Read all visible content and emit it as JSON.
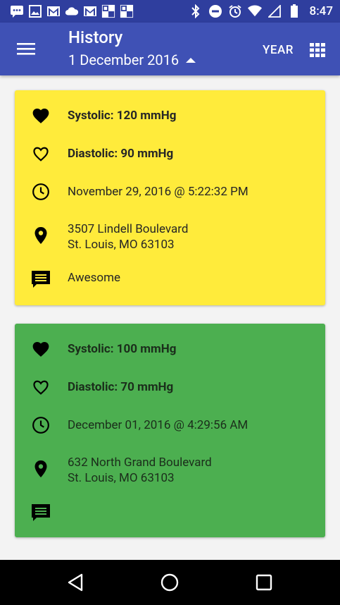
{
  "status_bar": {
    "time": "8:47"
  },
  "app_bar": {
    "title": "History",
    "date": "1 December 2016",
    "year_label": "YEAR"
  },
  "entries": [
    {
      "systolic": "Systolic: 120 mmHg",
      "diastolic": "Diastolic: 90 mmHg",
      "datetime": "November 29, 2016 @ 5:22:32 PM",
      "address_line1": "3507 Lindell Boulevard",
      "address_line2": "St. Louis, MO 63103",
      "comment": "Awesome",
      "color": "#ffeb3b"
    },
    {
      "systolic": "Systolic: 100 mmHg",
      "diastolic": "Diastolic: 70 mmHg",
      "datetime": "December 01, 2016 @ 4:29:56 AM",
      "address_line1": "632 North Grand Boulevard",
      "address_line2": "St. Louis, MO 63103",
      "comment": "",
      "color": "#4caf50"
    }
  ],
  "colors": {
    "status_bar": "#2f3e9e",
    "app_bar": "#3f51b5",
    "card_yellow": "#ffeb3b",
    "card_green": "#4caf50"
  }
}
